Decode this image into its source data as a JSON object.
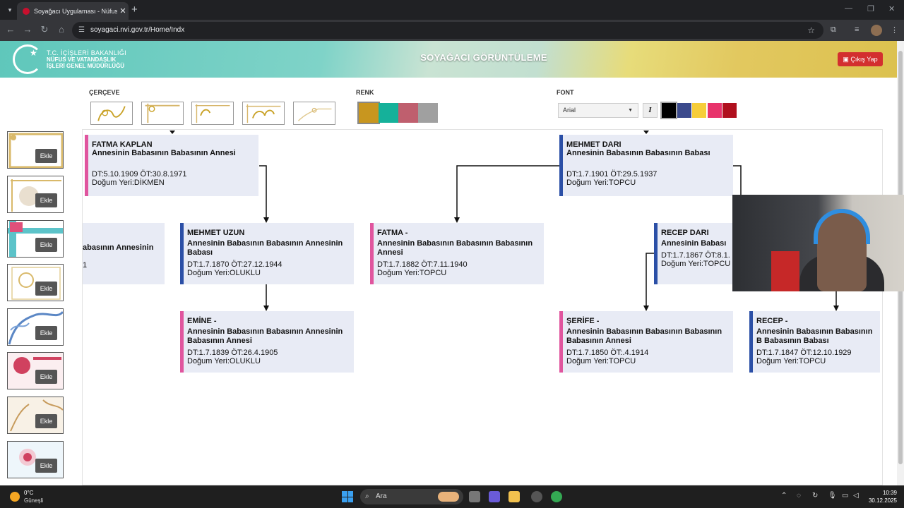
{
  "browser": {
    "tab_title": "Soyağacı Uygulaması - Nüfus ve",
    "url": "soyagaci.nvi.gov.tr/Home/Indx"
  },
  "header": {
    "org_line1": "T.C. İÇİŞLERİ BAKANLIĞI",
    "org_line2": "NÜFUS VE VATANDAŞLIK",
    "org_line3": "İŞLERİ GENEL MÜDÜRLÜĞÜ",
    "title": "SOYAĞACI GÖRÜNTÜLEME",
    "logout_label": "Çıkış Yap"
  },
  "controls": {
    "frame_label": "ÇERÇEVE",
    "color_label": "RENK",
    "font_label": "FONT",
    "font_value": "Arial",
    "italic_label": "I",
    "colors": [
      "#c8961f",
      "#15b19a",
      "#bf5f6e",
      "#a0a0a0"
    ],
    "font_colors": [
      "#000000",
      "#3b4a8c",
      "#f6cd3a",
      "#e8336b",
      "#b0101e"
    ]
  },
  "sidebar": {
    "add_label": "Ekle"
  },
  "tree": {
    "nodes": [
      {
        "name": "FATMA KAPLAN",
        "relation": "Annesinin Babasının Babasının Annesi",
        "dates": "DT:5.10.1909 ÖT:30.8.1971",
        "place": "Doğum Yeri:DİKMEN",
        "gender": "female"
      },
      {
        "name": "MEHMET DARI",
        "relation": "Annesinin Babasının Babasının Babası",
        "dates": "DT:1.7.1901 ÖT:29.5.1937",
        "place": "Doğum Yeri:TOPCU",
        "gender": "male"
      },
      {
        "name": "",
        "relation": "abasının Annesinin",
        "dates": "1",
        "place": "",
        "gender": "female"
      },
      {
        "name": "MEHMET UZUN",
        "relation": "Annesinin Babasının Babasının Annesinin Babası",
        "dates": "DT:1.7.1870 ÖT:27.12.1944",
        "place": "Doğum Yeri:OLUKLU",
        "gender": "male"
      },
      {
        "name": "FATMA -",
        "relation": "Annesinin Babasının Babasının Babasının Annesi",
        "dates": "DT:1.7.1882 ÖT:7.11.1940",
        "place": "Doğum Yeri:TOPCU",
        "gender": "female"
      },
      {
        "name": "RECEP DARI",
        "relation": "Annesinin Babası",
        "dates": "DT:1.7.1867 ÖT:8.1.",
        "place": "Doğum Yeri:TOPCU",
        "gender": "male"
      },
      {
        "name": "EMİNE -",
        "relation": "Annesinin Babasının Babasının Annesinin Babasının Annesi",
        "dates": "DT:1.7.1839 ÖT:26.4.1905",
        "place": "Doğum Yeri:OLUKLU",
        "gender": "female"
      },
      {
        "name": "ŞERİFE -",
        "relation": "Annesinin Babasının Babasının Babasının Babasının Annesi",
        "dates": "DT:1.7.1850 ÖT:.4.1914",
        "place": "Doğum Yeri:TOPCU",
        "gender": "female"
      },
      {
        "name": "RECEP -",
        "relation": "Annesinin Babasının Babasının B Babasının Babası",
        "dates": "DT:1.7.1847 ÖT:12.10.1929",
        "place": "Doğum Yeri:TOPCU",
        "gender": "male"
      }
    ]
  },
  "taskbar": {
    "temp": "0°C",
    "weather": "Güneşli",
    "search_placeholder": "Ara",
    "time": "10:39",
    "date": "30.12.2025"
  }
}
